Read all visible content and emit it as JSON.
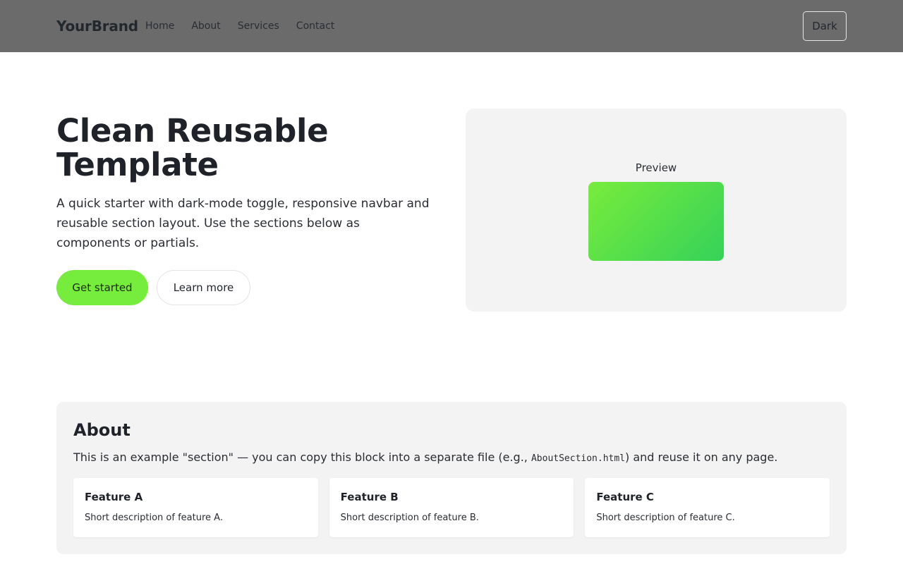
{
  "navbar": {
    "brand": "YourBrand",
    "links": [
      "Home",
      "About",
      "Services",
      "Contact"
    ],
    "theme_toggle_label": "Dark"
  },
  "hero": {
    "title": "Clean Reusable Template",
    "subtitle": "A quick starter with dark-mode toggle, responsive navbar and reusable section layout. Use the sections below as components or partials.",
    "primary_button": "Get started",
    "secondary_button": "Learn more",
    "preview_label": "Preview"
  },
  "about": {
    "title": "About",
    "text_before": "This is an example \"section\" — you can copy this block into a separate file (e.g., ",
    "text_code": "AboutSection.html",
    "text_after": ") and reuse it on any page.",
    "features": [
      {
        "title": "Feature A",
        "description": "Short description of feature A."
      },
      {
        "title": "Feature B",
        "description": "Short description of feature B."
      },
      {
        "title": "Feature C",
        "description": "Short description of feature C."
      }
    ]
  },
  "colors": {
    "navbar_bg": "#6b6b6b",
    "accent": "#76ec3c",
    "accent_gradient_end": "#35d259",
    "panel_bg": "#f3f3f3"
  }
}
